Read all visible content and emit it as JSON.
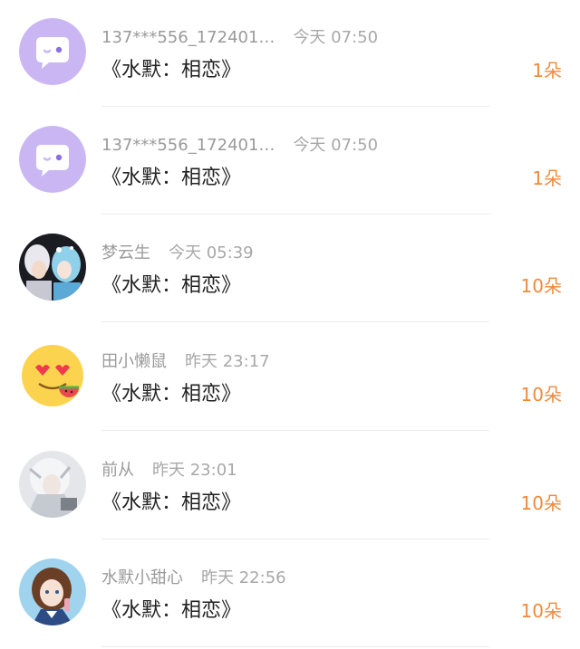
{
  "messages": [
    {
      "user": "137***556_172401…",
      "time": "今天 07:50",
      "title": "《水默：相恋》",
      "gift": "1朵",
      "avatar": "default-chat-avatar"
    },
    {
      "user": "137***556_172401…",
      "time": "今天 07:50",
      "title": "《水默：相恋》",
      "gift": "1朵",
      "avatar": "default-chat-avatar"
    },
    {
      "user": "梦云生",
      "time": "今天 05:39",
      "title": "《水默：相恋》",
      "gift": "10朵",
      "avatar": "anime-couple-avatar"
    },
    {
      "user": "田小懒鼠",
      "time": "昨天 23:17",
      "title": "《水默：相恋》",
      "gift": "10朵",
      "avatar": "heart-eyes-emoji-avatar"
    },
    {
      "user": "前从",
      "time": "昨天 23:01",
      "title": "《水默：相恋》",
      "gift": "10朵",
      "avatar": "white-hair-anime-avatar"
    },
    {
      "user": "水默小甜心",
      "time": "昨天 22:56",
      "title": "《水默：相恋》",
      "gift": "10朵",
      "avatar": "anime-girl-avatar"
    }
  ],
  "colors": {
    "gift": "#f08a3c",
    "default_avatar": "#c9b6f3"
  }
}
